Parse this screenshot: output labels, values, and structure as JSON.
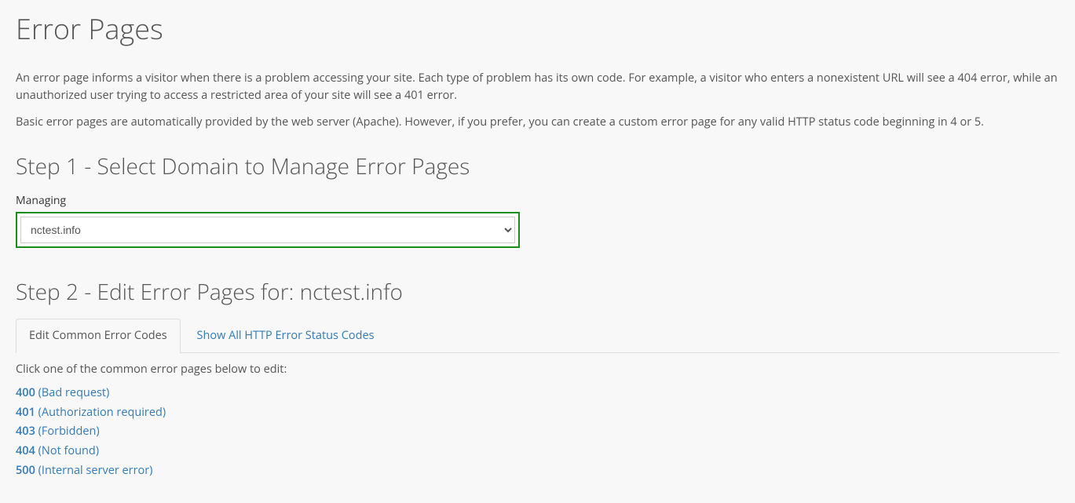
{
  "page_title": "Error Pages",
  "intro_p1": "An error page informs a visitor when there is a problem accessing your site. Each type of problem has its own code. For example, a visitor who enters a nonexistent URL will see a 404 error, while an unauthorized user trying to access a restricted area of your site will see a 401 error.",
  "intro_p2": "Basic error pages are automatically provided by the web server (Apache). However, if you prefer, you can create a custom error page for any valid HTTP status code beginning in 4 or 5.",
  "step1": {
    "heading": "Step 1 - Select Domain to Manage Error Pages",
    "label": "Managing",
    "selected": "nctest.info"
  },
  "step2": {
    "heading": "Step 2 - Edit Error Pages for: nctest.info",
    "tabs": {
      "common": "Edit Common Error Codes",
      "all": "Show All HTTP Error Status Codes"
    },
    "instruction": "Click one of the common error pages below to edit:",
    "errors": [
      {
        "code": "400",
        "desc": "(Bad request)"
      },
      {
        "code": "401",
        "desc": "(Authorization required)"
      },
      {
        "code": "403",
        "desc": "(Forbidden)"
      },
      {
        "code": "404",
        "desc": "(Not found)"
      },
      {
        "code": "500",
        "desc": "(Internal server error)"
      }
    ]
  }
}
